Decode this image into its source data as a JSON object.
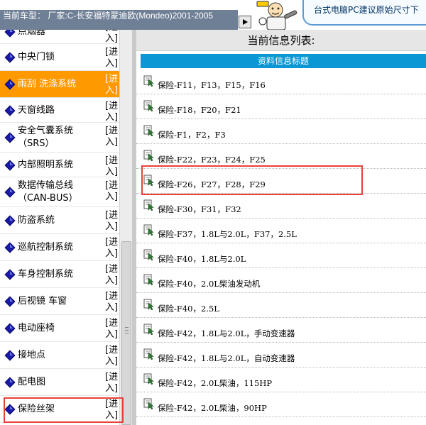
{
  "header": {
    "car_model": "当前车型： 厂家:C-长安福特蒙迪欧(Mondeo)2001-2005",
    "notice": "台式电脑PC建议原始尺寸下",
    "arrow_label": "▶"
  },
  "nav": {
    "enter_label": "[进入]",
    "items": [
      {
        "label": "点烟器",
        "active": false
      },
      {
        "label": "中央门锁",
        "active": false
      },
      {
        "label": "雨刮 洗涤系统",
        "active": true
      },
      {
        "label": "天窗线路",
        "active": false
      },
      {
        "label": "安全气囊系统（SRS）",
        "active": false
      },
      {
        "label": "内部照明系统",
        "active": false
      },
      {
        "label": "数据传输总线（CAN-BUS）",
        "active": false
      },
      {
        "label": "防盗系统",
        "active": false
      },
      {
        "label": "巡航控制系统",
        "active": false
      },
      {
        "label": "车身控制系统",
        "active": false
      },
      {
        "label": "后视镜 车窗",
        "active": false
      },
      {
        "label": "电动座椅",
        "active": false
      },
      {
        "label": "接地点",
        "active": false
      },
      {
        "label": "配电图",
        "active": false
      },
      {
        "label": "保险丝架",
        "active": false
      }
    ]
  },
  "main": {
    "list_title": "当前信息列表:",
    "column_header": "资料信息标题",
    "rows": [
      "保险-F11，F13，F15，F16",
      "保险-F18，F20，F21",
      "保险-F1，F2，F3",
      "保险-F22，F23，F24，F25",
      "保险-F26，F27，F28，F29",
      "保险-F30，F31，F32",
      "保险-F37，1.8L与2.0L，F37，2.5L",
      "保险-F40，1.8L与2.0L",
      "保险-F40，2.0L柴油发动机",
      "保险-F40，2.5L",
      "保险-F42，1.8L与2.0L，手动变速器",
      "保险-F42，1.8L与2.0L，自动变速器",
      "保险-F42，2.0L柴油，115HP",
      "保险-F42，2.0L柴油，90HP"
    ]
  },
  "colors": {
    "accent_orange": "#ff9900",
    "header_blue": "#0b97d3",
    "highlight_red": "#e8413a"
  }
}
